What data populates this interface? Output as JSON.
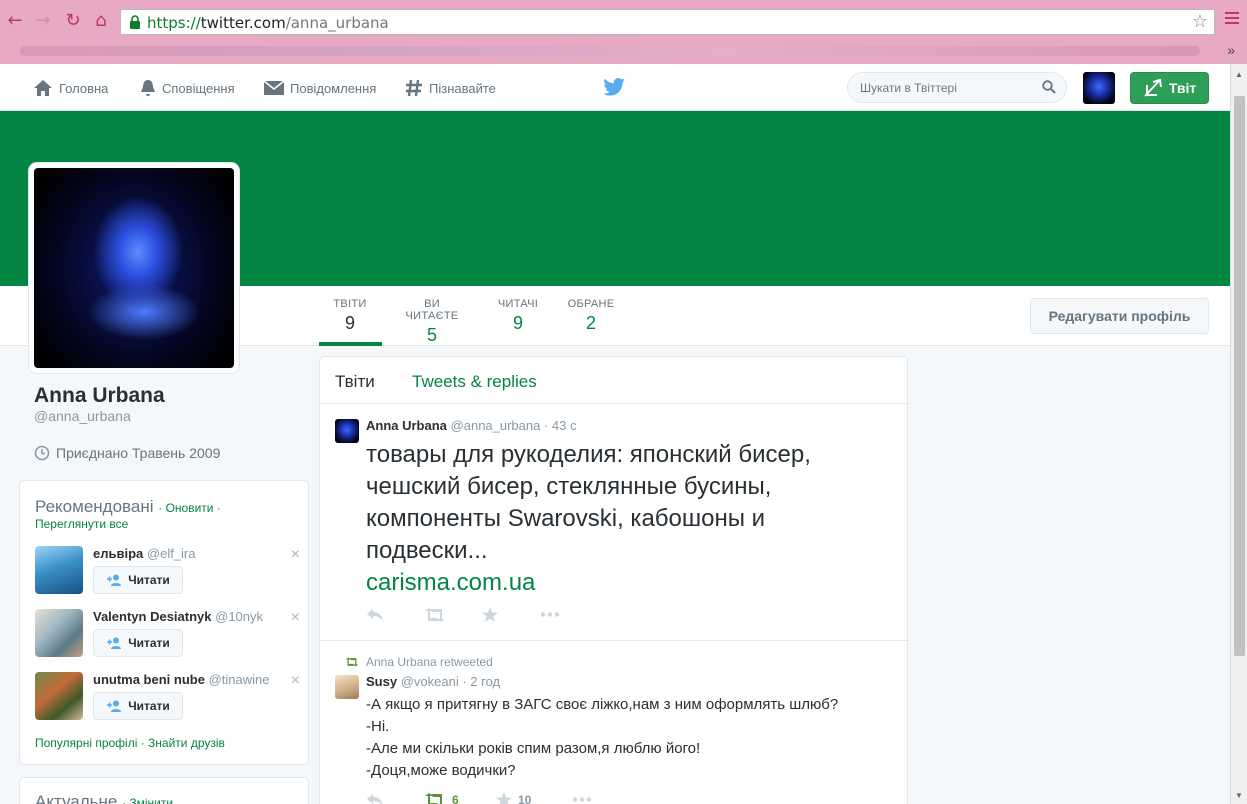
{
  "browser": {
    "url_scheme": "https://",
    "url_host": "twitter.com",
    "url_path": "/anna_urbana",
    "more_bookmarks": "»"
  },
  "nav": {
    "home": "Головна",
    "notifications": "Сповіщення",
    "messages": "Повідомлення",
    "discover": "Пізнавайте",
    "search_placeholder": "Шукати в Твіттері",
    "tweet_button": "Твіт"
  },
  "profile": {
    "name": "Anna Urbana",
    "handle": "@anna_urbana",
    "joined": "Приєднано Травень 2009",
    "edit_button": "Редагувати профіль",
    "header_color": "#038543",
    "stats": [
      {
        "label": "ТВІТИ",
        "value": "9"
      },
      {
        "label": "ВИ ЧИТАЄТЕ",
        "value": "5"
      },
      {
        "label": "ЧИТАЧІ",
        "value": "9"
      },
      {
        "label": "ОБРАНЕ",
        "value": "2"
      }
    ]
  },
  "recommended": {
    "title": "Рекомендовані",
    "refresh": "· Оновити ·",
    "see_all": "Переглянути все",
    "follow_label": "Читати",
    "close": "×",
    "items": [
      {
        "name": "ельвіра",
        "handle": "@elf_ira"
      },
      {
        "name": "Valentyn Desiatnyk",
        "handle": "@10nyk"
      },
      {
        "name": "unutma beni nube",
        "handle": "@tinawine"
      }
    ],
    "footer": "Популярні профілі · Знайти друзів"
  },
  "trends": {
    "title": "Актуальне",
    "change": "· Змінити"
  },
  "timeline": {
    "tabs": [
      "Твіти",
      "Tweets & replies"
    ],
    "tweets": [
      {
        "name": "Anna Urbana",
        "handle": "@anna_urbana",
        "time": "· 43 с",
        "text": "товары для рукоделия: японский бисер, чешский бисер, стеклянные бусины, компоненты Swarovski, кабошоны и подвески...",
        "link": "carisma.com.ua"
      },
      {
        "retweeted_by": "Anna Urbana retweeted",
        "name": "Susy",
        "handle": "@vokeani",
        "time": "· 2 год",
        "lines": [
          "-А якщо я притягну в ЗАГС своє ліжко,нам з ним оформлять шлюб?",
          "-Ні.",
          "-Але ми скільки років спим разом,я люблю його!",
          "-Доця,може водички?"
        ],
        "retweets": "6",
        "favorites": "10"
      }
    ]
  }
}
